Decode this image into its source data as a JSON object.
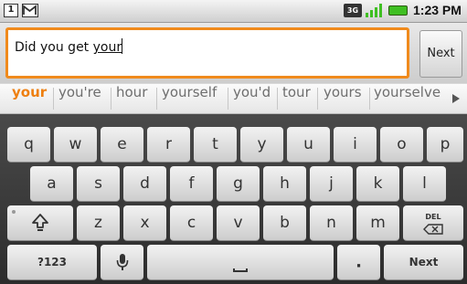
{
  "status_bar": {
    "notification_1": "1",
    "notification_2_icon": "gmail-icon",
    "network_type": "3G",
    "signal_icon": "signal-icon",
    "battery_icon": "battery-icon",
    "time": "1:23 PM"
  },
  "entry": {
    "committed_text": "Did you get ",
    "composing_text": "your",
    "next_label": "Next",
    "focus_color": "#f08a1c"
  },
  "suggestions": {
    "items": [
      "your",
      "you're",
      "hour",
      "yourself",
      "you'd",
      "tour",
      "yours",
      "yourselve"
    ],
    "highlight_color": "#ee7f10",
    "more_icon": "more-arrow-icon"
  },
  "keyboard": {
    "rows": [
      [
        "q",
        "w",
        "e",
        "r",
        "t",
        "y",
        "u",
        "i",
        "o",
        "p"
      ],
      [
        "a",
        "s",
        "d",
        "f",
        "g",
        "h",
        "j",
        "k",
        "l"
      ],
      [
        "z",
        "x",
        "c",
        "v",
        "b",
        "n",
        "m"
      ]
    ],
    "shift_icon": "shift-icon",
    "delete_label": "DEL",
    "symbols_label": "?123",
    "mic_icon": "microphone-icon",
    "space_icon": "space-icon",
    "period_label": ".",
    "enter_label": "Next"
  }
}
